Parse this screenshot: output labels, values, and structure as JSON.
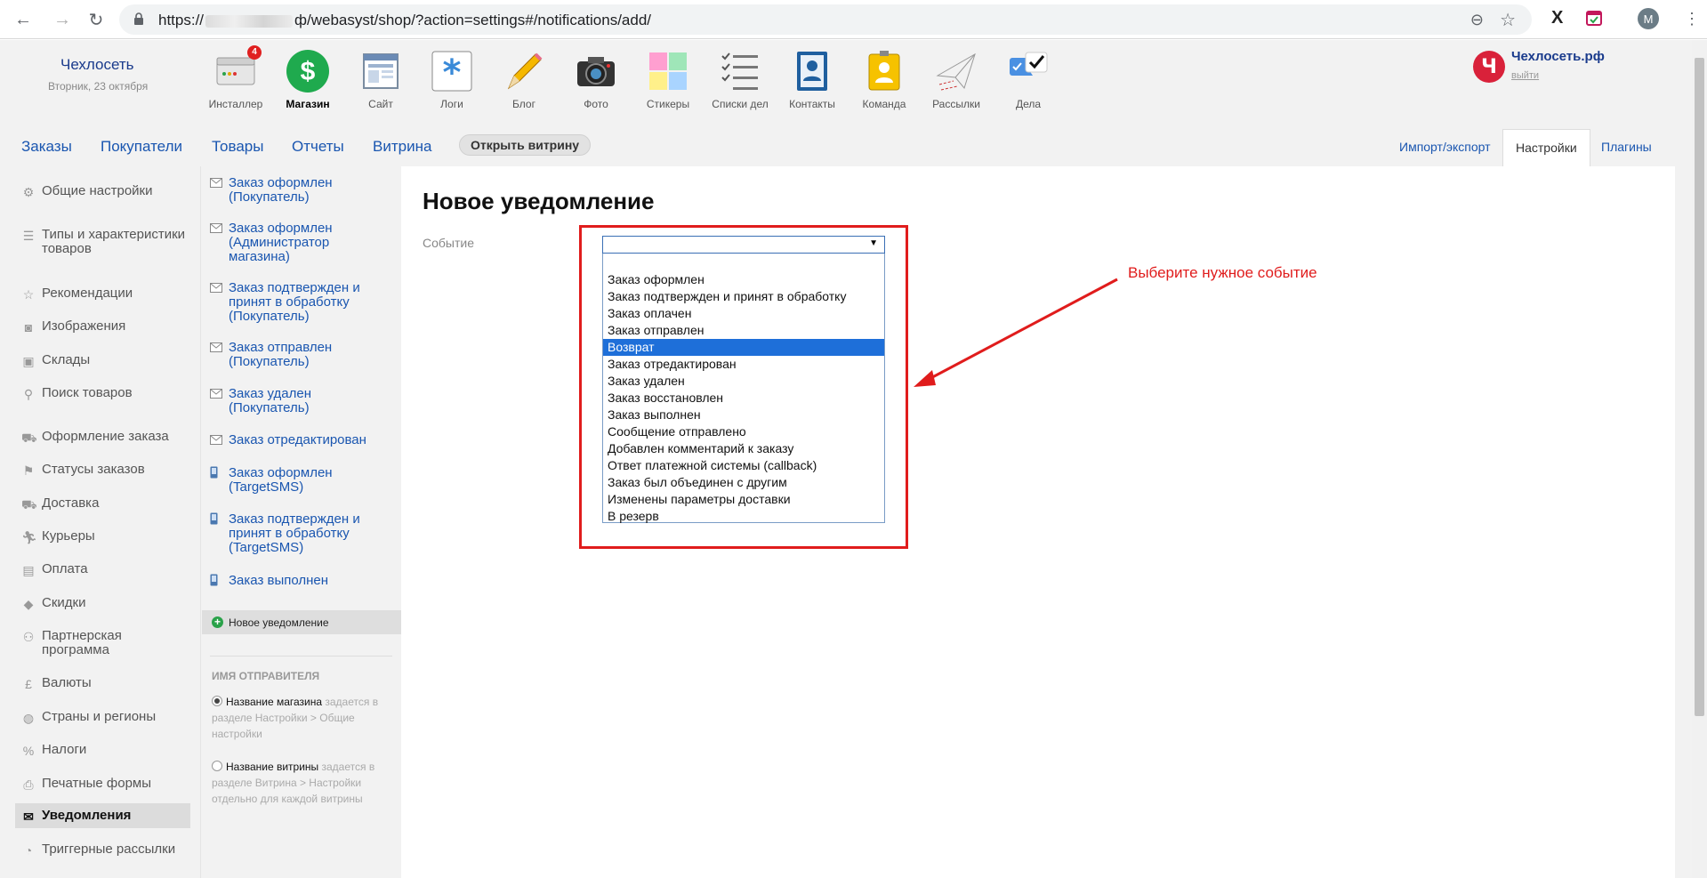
{
  "browser": {
    "url_prefix": "https://",
    "url_suffix": "ф/webasyst/shop/?action=settings#/notifications/add/",
    "profile_initial": "M"
  },
  "header": {
    "account_name": "Чехлосеть",
    "account_date": "Вторник, 23 октября",
    "brand_letter": "Ч",
    "brand_name": "Чехлосеть.рф",
    "logout": "выйти",
    "apps": [
      {
        "label": "Инсталлер",
        "icon": "installer-icon",
        "badge": "4"
      },
      {
        "label": "Магазин",
        "icon": "shop-icon",
        "active": true
      },
      {
        "label": "Сайт",
        "icon": "site-icon"
      },
      {
        "label": "Логи",
        "icon": "logs-icon"
      },
      {
        "label": "Блог",
        "icon": "blog-icon"
      },
      {
        "label": "Фото",
        "icon": "photo-icon"
      },
      {
        "label": "Стикеры",
        "icon": "stickers-icon"
      },
      {
        "label": "Списки дел",
        "icon": "checklists-icon"
      },
      {
        "label": "Контакты",
        "icon": "contacts-icon"
      },
      {
        "label": "Команда",
        "icon": "team-icon"
      },
      {
        "label": "Рассылки",
        "icon": "mailer-icon"
      },
      {
        "label": "Дела",
        "icon": "tasks-icon"
      }
    ]
  },
  "maintabs": [
    "Заказы",
    "Покупатели",
    "Товары",
    "Отчеты",
    "Витрина"
  ],
  "open_store": "Открыть витрину",
  "righttabs": [
    "Импорт/экспорт",
    "Настройки",
    "Плагины"
  ],
  "sidebar": [
    {
      "label": "Общие настройки",
      "icon": "gear-icon"
    },
    {
      "label": "Типы и характеристики товаров",
      "icon": "list-icon"
    },
    {
      "label": "Рекомендации",
      "icon": "star-icon"
    },
    {
      "label": "Изображения",
      "icon": "camera-icon"
    },
    {
      "label": "Склады",
      "icon": "box-icon"
    },
    {
      "label": "Поиск товаров",
      "icon": "search-icon"
    },
    {
      "label": "Оформление заказа",
      "icon": "cart-icon"
    },
    {
      "label": "Статусы заказов",
      "icon": "flag-icon"
    },
    {
      "label": "Доставка",
      "icon": "truck-icon"
    },
    {
      "label": "Курьеры",
      "icon": "runner-icon"
    },
    {
      "label": "Оплата",
      "icon": "wallet-icon"
    },
    {
      "label": "Скидки",
      "icon": "tag-icon"
    },
    {
      "label": "Партнерская программа",
      "icon": "partner-icon"
    },
    {
      "label": "Валюты",
      "icon": "currency-icon"
    },
    {
      "label": "Страны и регионы",
      "icon": "globe-icon"
    },
    {
      "label": "Налоги",
      "icon": "percent-icon"
    },
    {
      "label": "Печатные формы",
      "icon": "printer-icon"
    },
    {
      "label": "Уведомления",
      "icon": "envelope-icon",
      "active": true
    },
    {
      "label": "Триггерные рассылки",
      "icon": "trigger-icon"
    }
  ],
  "notifications": [
    {
      "label": "Заказ оформлен (Покупатель)",
      "type": "email"
    },
    {
      "label": "Заказ оформлен (Администратор магазина)",
      "type": "email"
    },
    {
      "label": "Заказ подтвержден и принят в обработку (Покупатель)",
      "type": "email"
    },
    {
      "label": "Заказ отправлен (Покупатель)",
      "type": "email"
    },
    {
      "label": "Заказ удален (Покупатель)",
      "type": "email"
    },
    {
      "label": "Заказ отредактирован",
      "type": "email"
    },
    {
      "label": "Заказ оформлен (TargetSMS)",
      "type": "sms"
    },
    {
      "label": "Заказ подтвержден и принят в обработку (TargetSMS)",
      "type": "sms"
    },
    {
      "label": "Заказ выполнен",
      "type": "sms"
    }
  ],
  "new_notification": "Новое уведомление",
  "sender": {
    "title": "ИМЯ ОТПРАВИТЕЛЯ",
    "options": [
      {
        "strong": "Название магазина",
        "hint": " задается в разделе Настройки > Общие настройки",
        "checked": true
      },
      {
        "strong": "Название витрины",
        "hint": " задается в разделе Витрина > Настройки отдельно для каждой витрины",
        "checked": false
      }
    ]
  },
  "content": {
    "title": "Новое уведомление",
    "event_label": "Событие",
    "event_value": "",
    "options": [
      "Заказ оформлен",
      "Заказ подтвержден и принят в обработку",
      "Заказ оплачен",
      "Заказ отправлен",
      "Возврат",
      "Заказ отредактирован",
      "Заказ удален",
      "Заказ восстановлен",
      "Заказ выполнен",
      "Сообщение отправлено",
      "Добавлен комментарий к заказу",
      "Ответ платежной системы (callback)",
      "Заказ был объединен с другим",
      "Изменены параметры доставки",
      "В резерв"
    ],
    "highlighted_option": "Возврат",
    "annotation": "Выберите нужное событие",
    "annotation_color": "#e01c1c",
    "accent_color": "#1a56b0",
    "selection_color": "#1e6fd9"
  }
}
